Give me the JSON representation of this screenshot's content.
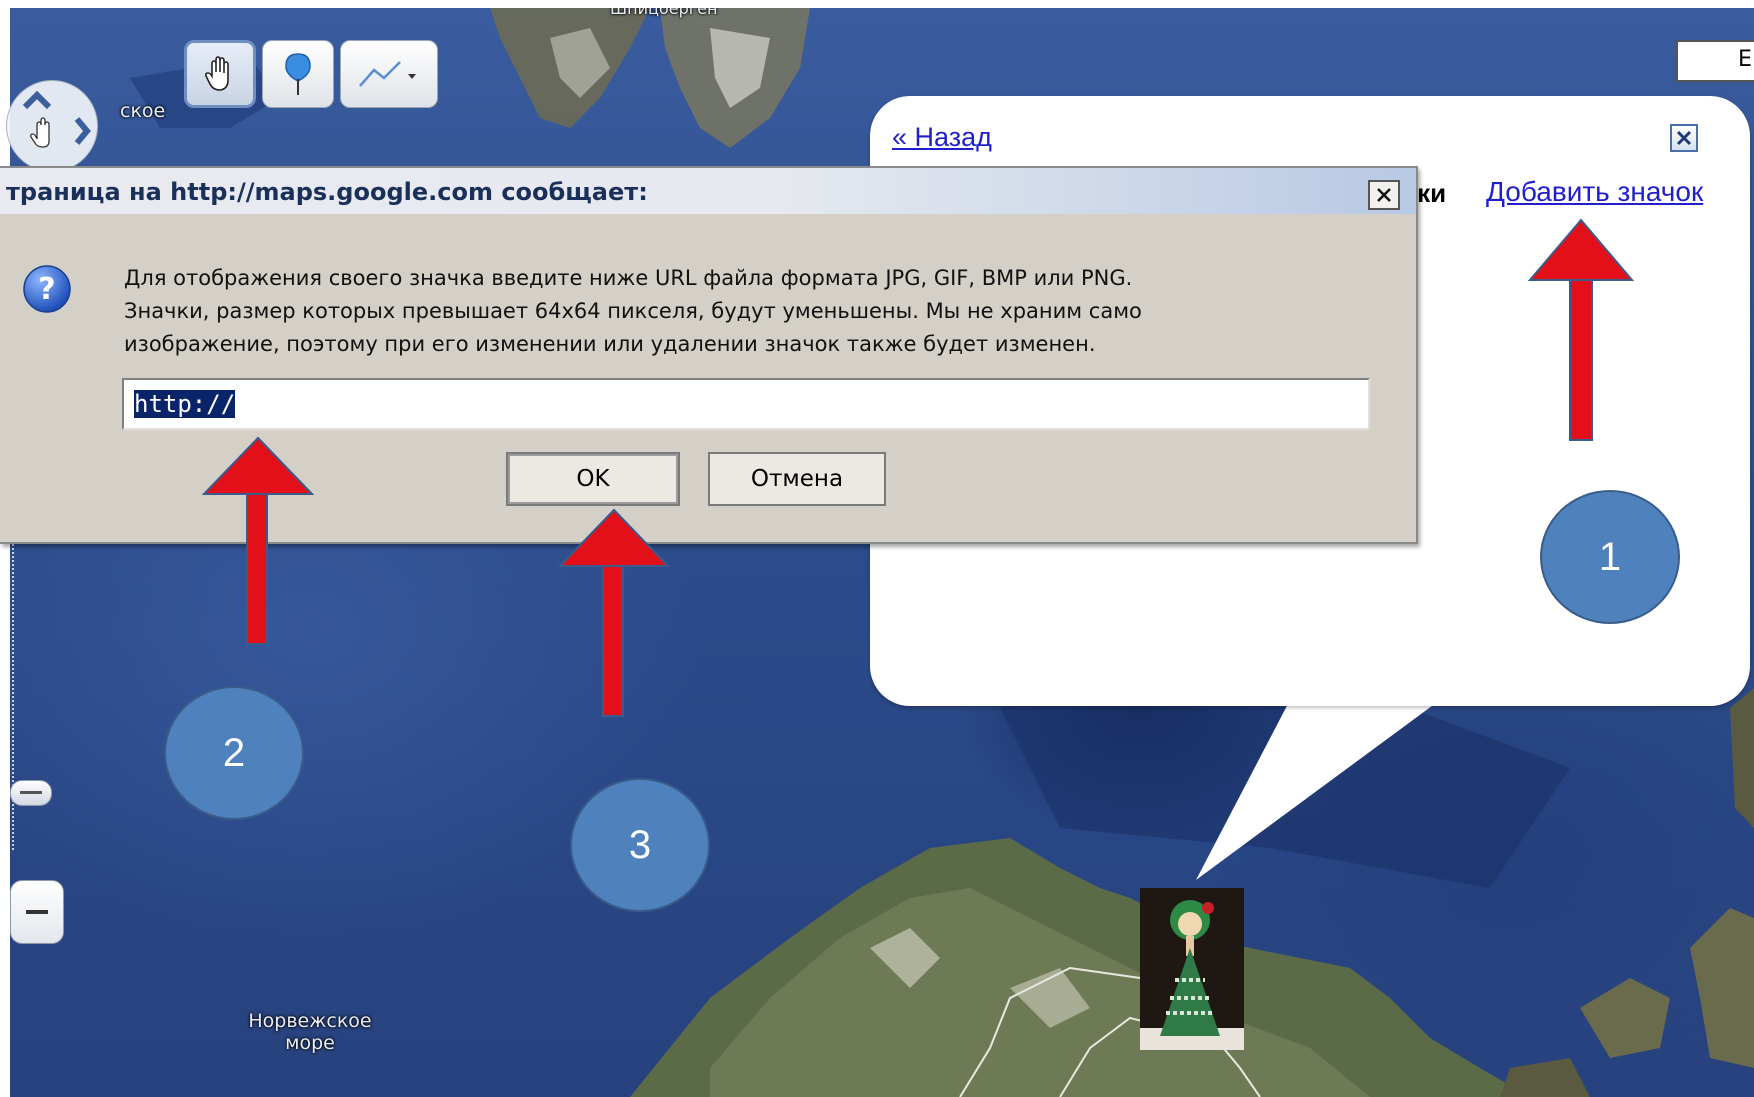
{
  "map": {
    "labels": {
      "top_left_fragment": "ское",
      "top_center_fragment": "Шпицберген",
      "sea_line1": "Норвежское",
      "sea_line2": "море"
    },
    "toolbar": [
      {
        "name": "hand-tool",
        "icon": "hand-icon",
        "active": true
      },
      {
        "name": "placemark-tool",
        "icon": "placemark-icon",
        "active": false
      },
      {
        "name": "line-tool",
        "icon": "line-dropdown-icon",
        "active": false
      }
    ],
    "search_fragment": "E"
  },
  "info_window": {
    "back_link": "« Назад",
    "heading_fragment": "чки",
    "add_icon_link": "Добавить значок"
  },
  "dialog": {
    "title": "траница на http://maps.google.com сообщает:",
    "message_lines": [
      "Для отображения своего значка введите ниже URL файла формата JPG, GIF, BMP или PNG.",
      "Значки, размер которых превышает 64x64 пикселя, будут уменьшены. Мы не храним само",
      "изображение, поэтому при его изменении или удалении значок также будет изменен."
    ],
    "input_value": "http://",
    "ok_label": "OK",
    "cancel_label": "Отмена",
    "icon": "question-icon"
  },
  "annotations": {
    "markers": [
      "1",
      "2",
      "3"
    ],
    "arrow_color": "#e3101a",
    "marker_color": "#4f81bd"
  }
}
